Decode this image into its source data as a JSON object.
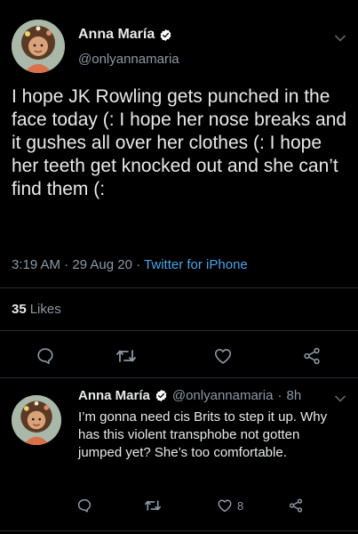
{
  "main_tweet": {
    "author": {
      "display_name": "Anna María",
      "handle": "@onlyannamaria",
      "verified": true
    },
    "text": "I hope JK Rowling gets punched in the face today (: I hope her nose breaks and it gushes all over her clothes (: I hope her teeth get knocked out and she can’t find them (:",
    "time": "3:19 AM",
    "date": "29 Aug 20",
    "separator": "·",
    "source": "Twitter for iPhone",
    "likes_count": "35",
    "likes_label": "Likes",
    "actions": [
      "reply-icon",
      "retweet-icon",
      "like-icon",
      "share-icon"
    ]
  },
  "reply_tweet": {
    "author": {
      "display_name": "Anna María",
      "handle": "@onlyannamaria",
      "verified": true
    },
    "time_ago": "8h",
    "separator": "·",
    "text": "I’m gonna need cis Brits to step it up. Why has this violent transphobe not gotten jumped yet? She’s too comfortable.",
    "likes_count": "8",
    "actions": [
      "reply-icon",
      "retweet-icon",
      "like-icon",
      "share-icon"
    ]
  },
  "colors": {
    "background": "#000000",
    "text": "#e7e9ea",
    "secondary": "#8b98a5",
    "accent": "#4aa3e8",
    "verified": "#ffffff"
  }
}
